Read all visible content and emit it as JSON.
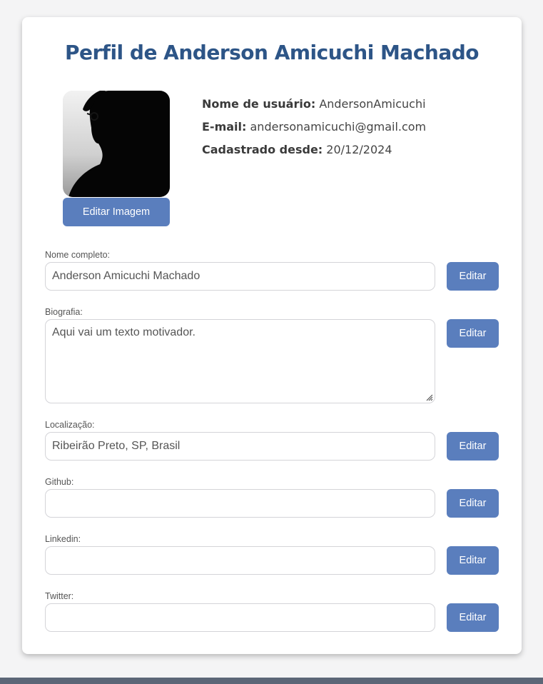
{
  "profile": {
    "title": "Perfil de Anderson Amicuchi Machado",
    "edit_image_label": "Editar Imagem",
    "username_label": "Nome de usuário:",
    "username_value": "AndersonAmicuchi",
    "email_label": "E-mail:",
    "email_value": "andersonamicuchi@gmail.com",
    "since_label": "Cadastrado desde:",
    "since_value": "20/12/2024"
  },
  "fields": {
    "fullname": {
      "label": "Nome completo:",
      "value": "Anderson Amicuchi Machado",
      "button": "Editar"
    },
    "bio": {
      "label": "Biografia:",
      "value": "Aqui vai um texto motivador.",
      "button": "Editar"
    },
    "location": {
      "label": "Localização:",
      "value": "Ribeirão Preto, SP, Brasil",
      "button": "Editar"
    },
    "github": {
      "label": "Github:",
      "value": "",
      "button": "Editar"
    },
    "linkedin": {
      "label": "Linkedin:",
      "value": "",
      "button": "Editar"
    },
    "twitter": {
      "label": "Twitter:",
      "value": "",
      "button": "Editar"
    }
  },
  "colors": {
    "title": "#2d5587",
    "button": "#5a7ebd",
    "footer": "#5c6677"
  }
}
